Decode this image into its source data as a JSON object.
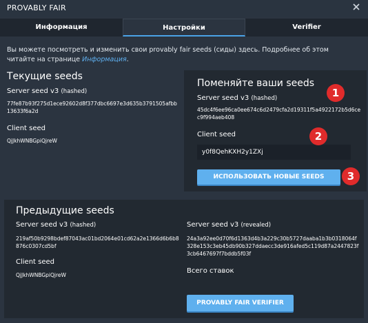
{
  "window": {
    "title": "PROVABLY FAIR"
  },
  "tabs": [
    {
      "label": "Информация",
      "active": false
    },
    {
      "label": "Настройки",
      "active": true
    },
    {
      "label": "Verifier",
      "active": false
    }
  ],
  "intro": {
    "text": "Вы можете посмотреть и изменить свои provably fair seeds (сиды) здесь. Подробнее об этом читайте на странице ",
    "link": "Информация",
    "end": "."
  },
  "current": {
    "title": "Текущие seeds",
    "server_label": "Server seed v3",
    "server_hint": "(hashed)",
    "server_value": "77fe87b93f275d1ece92602d8f377dbc6697e3d635b3791505afbb13633f6a2d",
    "client_label": "Client seed",
    "client_value": "QjJkhWNBGpiQjreW"
  },
  "change": {
    "title": "Поменяйте ваши seeds",
    "server_label": "Server seed v3",
    "server_hint": "(hashed)",
    "server_value": "45dc4f6ee96ca0ee674c6d2479cfa2d19311f5a4922172b5d6cec9f994aeb408",
    "client_label": "Client seed",
    "client_input": "y0f8QehKXH2y1ZXj",
    "button": "ИСПОЛЬЗОВАТЬ НОВЫЕ SEEDS",
    "badges": [
      "1",
      "2",
      "3"
    ],
    "badge_color": "#e02b2b"
  },
  "previous": {
    "title": "Предыдущие seeds",
    "server_hashed_label": "Server seed v3",
    "server_hashed_hint": "(hashed)",
    "server_hashed_value": "219af50b9298bdef87043ac01bd2064e01cd62a2e1366d6b6b8876c0307cd5bf",
    "server_revealed_label": "Server seed v3",
    "server_revealed_hint": "(revealed)",
    "server_revealed_value": "24a3a92ee0d70f6d1363d4b3a229c30b5727daaba1b3b0318064f328e153c3eb45db90b327ddaecc3de916afed5c119d87a2447823f3cb6467697f7bddb5f03f",
    "client_label": "Client seed",
    "client_value": "QjJkhWNBGpiQjreW",
    "total_bets_label": "Всего ставок",
    "button": "PROVABLY FAIR VERIFIER"
  },
  "colors": {
    "accent": "#5fb0ee",
    "link": "#5fb0f0",
    "background": "#2b3440",
    "panel": "#222931"
  }
}
